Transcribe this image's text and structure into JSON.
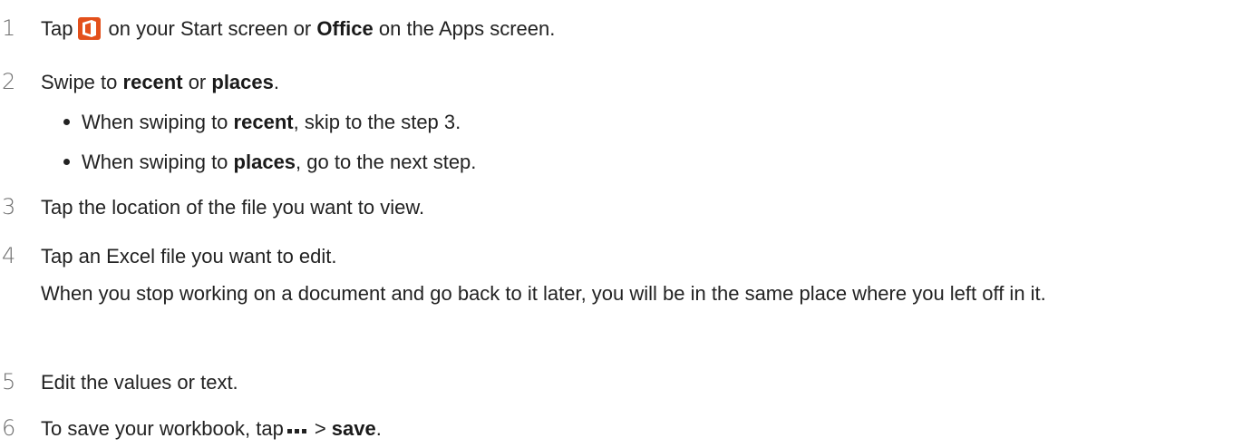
{
  "steps": [
    {
      "num": "1",
      "t1": "Tap",
      "t2": "on your Start screen or",
      "b1": "Office",
      "t3": "on the Apps screen.",
      "icon": "office-app-icon"
    },
    {
      "num": "2",
      "t1": "Swipe to",
      "b1": "recent",
      "t2": "or",
      "b2": "places",
      "t3": "."
    },
    {
      "num": "3",
      "t1": "Tap the location of the file you want to view."
    },
    {
      "num": "4",
      "t1": "Tap an Excel file you want to edit.",
      "note": "When you stop working on a document and go back to it later, you will be in the same place where you left off in it."
    },
    {
      "num": "5",
      "t1": "Edit the values or text."
    },
    {
      "num": "6",
      "t1": "To save your workbook, tap",
      "t2": ">",
      "b1": "save",
      "t3": ".",
      "icon": "more-icon"
    }
  ],
  "bullets": [
    {
      "t1": "When swiping to",
      "b1": "recent",
      "t2": ", skip to the step 3."
    },
    {
      "t1": "When swiping to",
      "b1": "places",
      "t2": ", go to the next step."
    }
  ],
  "colors": {
    "office_icon": "#e3501b",
    "text": "#222222",
    "step_number": "#6e6e6e"
  }
}
